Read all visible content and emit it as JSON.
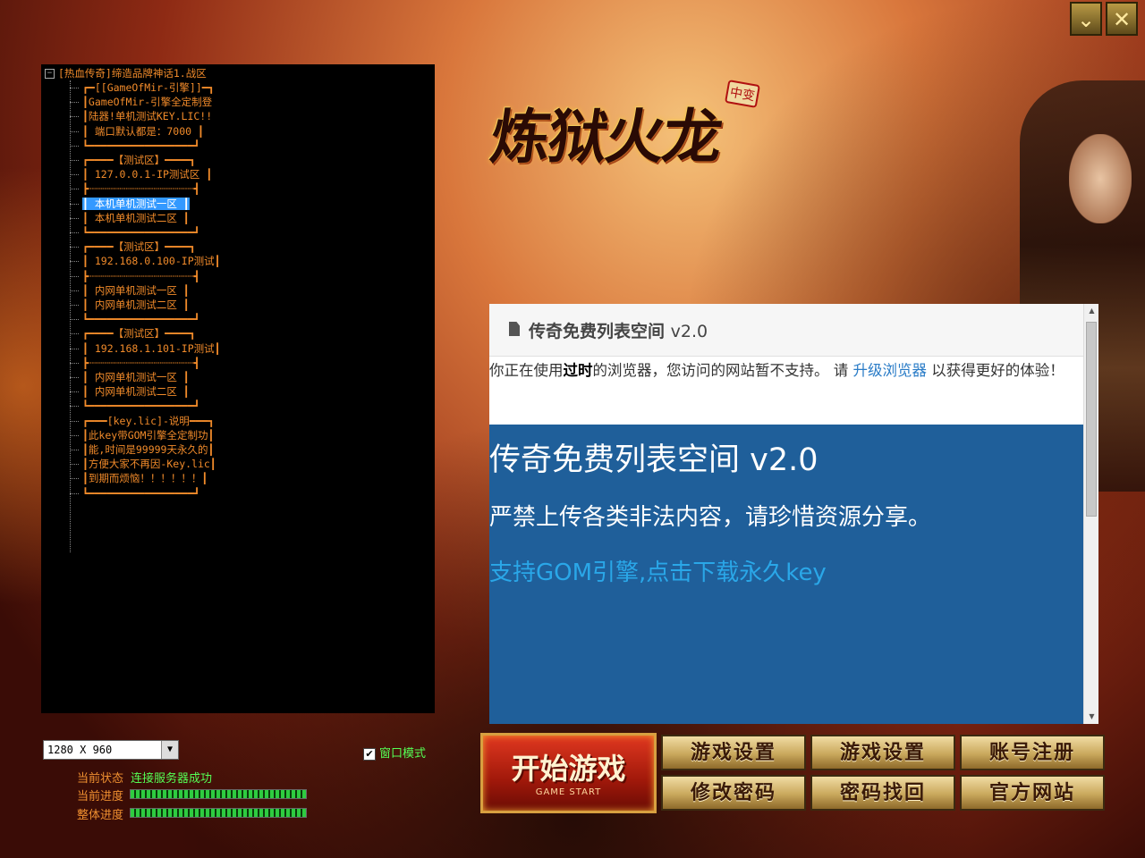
{
  "window": {
    "minimize_glyph": "⌄",
    "close_glyph": "✕"
  },
  "logo": {
    "title": "炼狱火龙",
    "badge": "中变"
  },
  "tree": {
    "root": "[热血传奇]缔造品牌神话1.战区",
    "lines": [
      {
        "text": "┏━[[GameOfMir-引擎]]━┓",
        "selected": false
      },
      {
        "text": "┃GameOfMir-引擎全定制登",
        "selected": false
      },
      {
        "text": "┃陆器!单机测试KEY.LIC!!",
        "selected": false
      },
      {
        "text": "┃  端口默认都是：7000   ┃",
        "selected": false
      },
      {
        "text": "┗━━━━━━━━━━━━━━━━━┛",
        "selected": false
      },
      {
        "text": "┏━━━━【测试区】━━━━┓",
        "selected": false
      },
      {
        "text": "┃ 127.0.0.1-IP测试区  ┃",
        "selected": false
      },
      {
        "text": "┣┈┈┈┈┈┈┈┈┈┈┈┈┈┈┈┈┈┫",
        "selected": false
      },
      {
        "text": "┃  本机单机测试一区   ┃",
        "selected": true
      },
      {
        "text": "┃  本机单机测试二区   ┃",
        "selected": false
      },
      {
        "text": "┗━━━━━━━━━━━━━━━━━┛",
        "selected": false
      },
      {
        "text": "┏━━━━【测试区】━━━━┓",
        "selected": false
      },
      {
        "text": "┃ 192.168.0.100-IP测试┃",
        "selected": false
      },
      {
        "text": "┣┈┈┈┈┈┈┈┈┈┈┈┈┈┈┈┈┈┫",
        "selected": false
      },
      {
        "text": "┃  内网单机测试一区   ┃",
        "selected": false
      },
      {
        "text": "┃  内网单机测试二区   ┃",
        "selected": false
      },
      {
        "text": "┗━━━━━━━━━━━━━━━━━┛",
        "selected": false
      },
      {
        "text": "┏━━━━【测试区】━━━━┓",
        "selected": false
      },
      {
        "text": "┃ 192.168.1.101-IP测试┃",
        "selected": false
      },
      {
        "text": "┣┈┈┈┈┈┈┈┈┈┈┈┈┈┈┈┈┈┫",
        "selected": false
      },
      {
        "text": "┃  内网单机测试一区   ┃",
        "selected": false
      },
      {
        "text": "┃  内网单机测试二区   ┃",
        "selected": false
      },
      {
        "text": "┗━━━━━━━━━━━━━━━━━┛",
        "selected": false
      },
      {
        "text": "┏━━━[key.lic]-说明━━━┓",
        "selected": false
      },
      {
        "text": "┃此key带GOM引擎全定制功┃",
        "selected": false
      },
      {
        "text": "┃能,时间是99999天永久的┃",
        "selected": false
      },
      {
        "text": "┃方便大家不再因-Key.lic┃",
        "selected": false
      },
      {
        "text": "┃到期而烦恼！！！！！！┃",
        "selected": false
      },
      {
        "text": "┗━━━━━━━━━━━━━━━━━┛",
        "selected": false
      }
    ]
  },
  "settings": {
    "resolution": "1280 X 960",
    "window_mode_label": "窗口模式",
    "window_mode_checked": "✔",
    "status_label": "当前状态",
    "status_value": "连接服务器成功",
    "progress1_label": "当前进度",
    "progress1": 1.0,
    "progress2_label": "整体进度",
    "progress2": 1.0
  },
  "browser": {
    "title": "传奇免费列表空间",
    "version": "v2.0",
    "notice_pre": "你正在使用",
    "notice_bold": "过时",
    "notice_mid": "的浏览器，您访问的网站暂不支持。 请 ",
    "notice_link": "升级浏览器",
    "notice_post": " 以获得更好的体验！",
    "hero_title": "传奇免费列表空间 v2.0",
    "hero_sub": "严禁上传各类非法内容，请珍惜资源分享。",
    "hero_link": "支持GOM引擎,点击下载永久key"
  },
  "buttons": {
    "start": "开始游戏",
    "start_sub": "GAME START",
    "game_settings_1": "游戏设置",
    "game_settings_2": "游戏设置",
    "register": "账号注册",
    "change_password": "修改密码",
    "recover_password": "密码找回",
    "official_site": "官方网站"
  },
  "colors": {
    "tree_text": "#f08a2a",
    "status_ok": "#55ff55",
    "browser_hero": "#1f5f9a",
    "link": "#2a7cc7"
  }
}
